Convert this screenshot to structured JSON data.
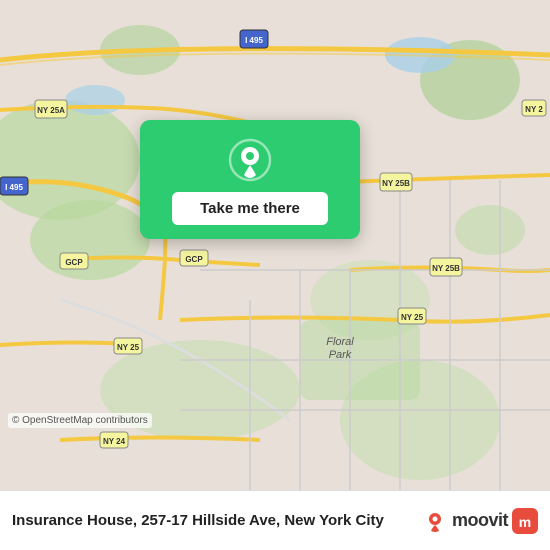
{
  "map": {
    "attribution": "© OpenStreetMap contributors",
    "bg_color": "#e8e0d8"
  },
  "popup": {
    "button_label": "Take me there",
    "pin_color": "white"
  },
  "bottom_bar": {
    "location_text": "Insurance House, 257-17 Hillside Ave, New York City",
    "location_bold": "Insurance House,",
    "moovit_label": "moovit"
  }
}
